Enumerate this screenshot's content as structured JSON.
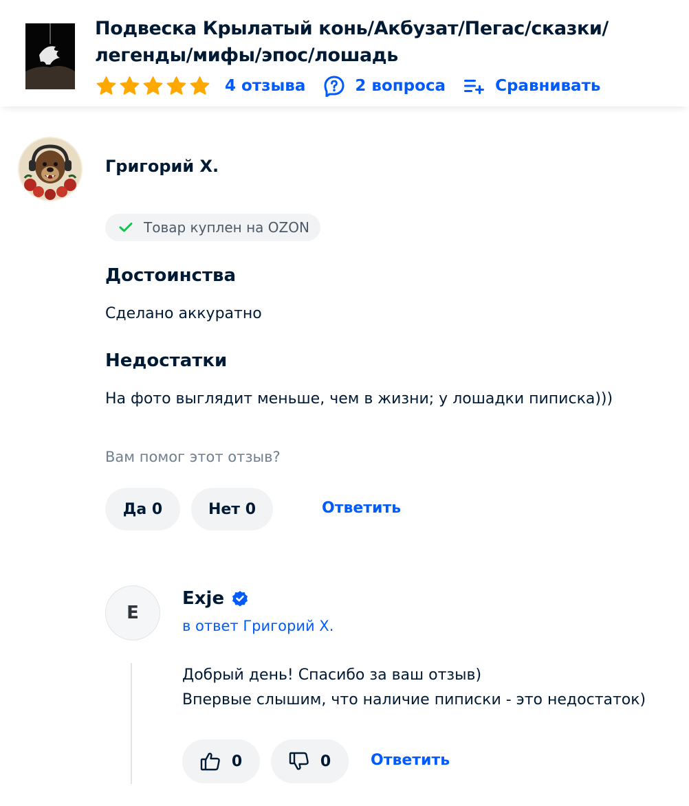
{
  "product": {
    "title": "Подвеска Крылатый конь/Акбузат/Пегас/сказки/ легенды/мифы/эпос/лошадь",
    "rating_stars": 5,
    "reviews_label": "4 отзыва",
    "questions_label": "2 вопроса",
    "compare_label": "Сравнивать"
  },
  "review": {
    "author": "Григорий Х.",
    "badge": "Товар куплен на OZON",
    "pros_heading": "Достоинства",
    "pros_text": "Сделано аккуратно",
    "cons_heading": "Недостатки",
    "cons_text": "На фото выглядит меньше, чем в жизни; у лошадки пиписка)))",
    "helpful_question": "Вам помог этот отзыв?",
    "yes_label": "Да 0",
    "no_label": "Нет 0",
    "reply_label": "Ответить"
  },
  "reply": {
    "avatar_letter": "E",
    "author": "Exje",
    "in_reply_to": "в ответ Григорий Х.",
    "text_line1": "Добрый день! Спасибо за ваш отзыв)",
    "text_line2": "Впервые слышим, что наличие пиписки - это недостаток)",
    "likes": "0",
    "dislikes": "0",
    "reply_label": "Ответить"
  },
  "colors": {
    "accent": "#005bff",
    "star": "#ffa800",
    "check": "#10c44c",
    "pill_bg": "#f2f3f5"
  },
  "icons": [
    "star-icon",
    "question-icon",
    "compare-icon",
    "check-icon",
    "verified-icon",
    "thumbs-up-icon",
    "thumbs-down-icon"
  ]
}
